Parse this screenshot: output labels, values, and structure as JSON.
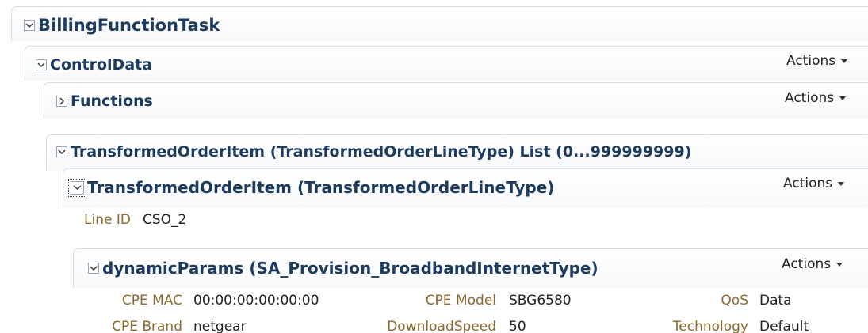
{
  "billing": {
    "title": "BillingFunctionTask"
  },
  "control_data": {
    "title": "ControlData",
    "actions_label": "Actions"
  },
  "functions": {
    "title": "Functions",
    "actions_label": "Actions"
  },
  "transformed_list": {
    "title": "TransformedOrderItem (TransformedOrderLineType) List (0...999999999)"
  },
  "transformed_item": {
    "title": "TransformedOrderItem (TransformedOrderLineType)",
    "actions_label": "Actions",
    "line_id_label": "Line ID",
    "line_id_value": "CSO_2"
  },
  "dynamic_params": {
    "title": "dynamicParams (SA_Provision_BroadbandInternetType)",
    "actions_label": "Actions",
    "fields": {
      "cpe_mac_label": "CPE MAC",
      "cpe_mac_value": "00:00:00:00:00:00",
      "cpe_model_label": "CPE Model",
      "cpe_model_value": "SBG6580",
      "qos_label": "QoS",
      "qos_value": "Data",
      "cpe_brand_label": "CPE Brand",
      "cpe_brand_value": "netgear",
      "download_speed_label": "DownloadSpeed",
      "download_speed_value": "50",
      "technology_label": "Technology",
      "technology_value": "Default"
    }
  },
  "icons": {
    "expanded": "chevron-down-icon",
    "collapsed": "chevron-right-icon",
    "actions_menu": "caret-down-icon"
  }
}
